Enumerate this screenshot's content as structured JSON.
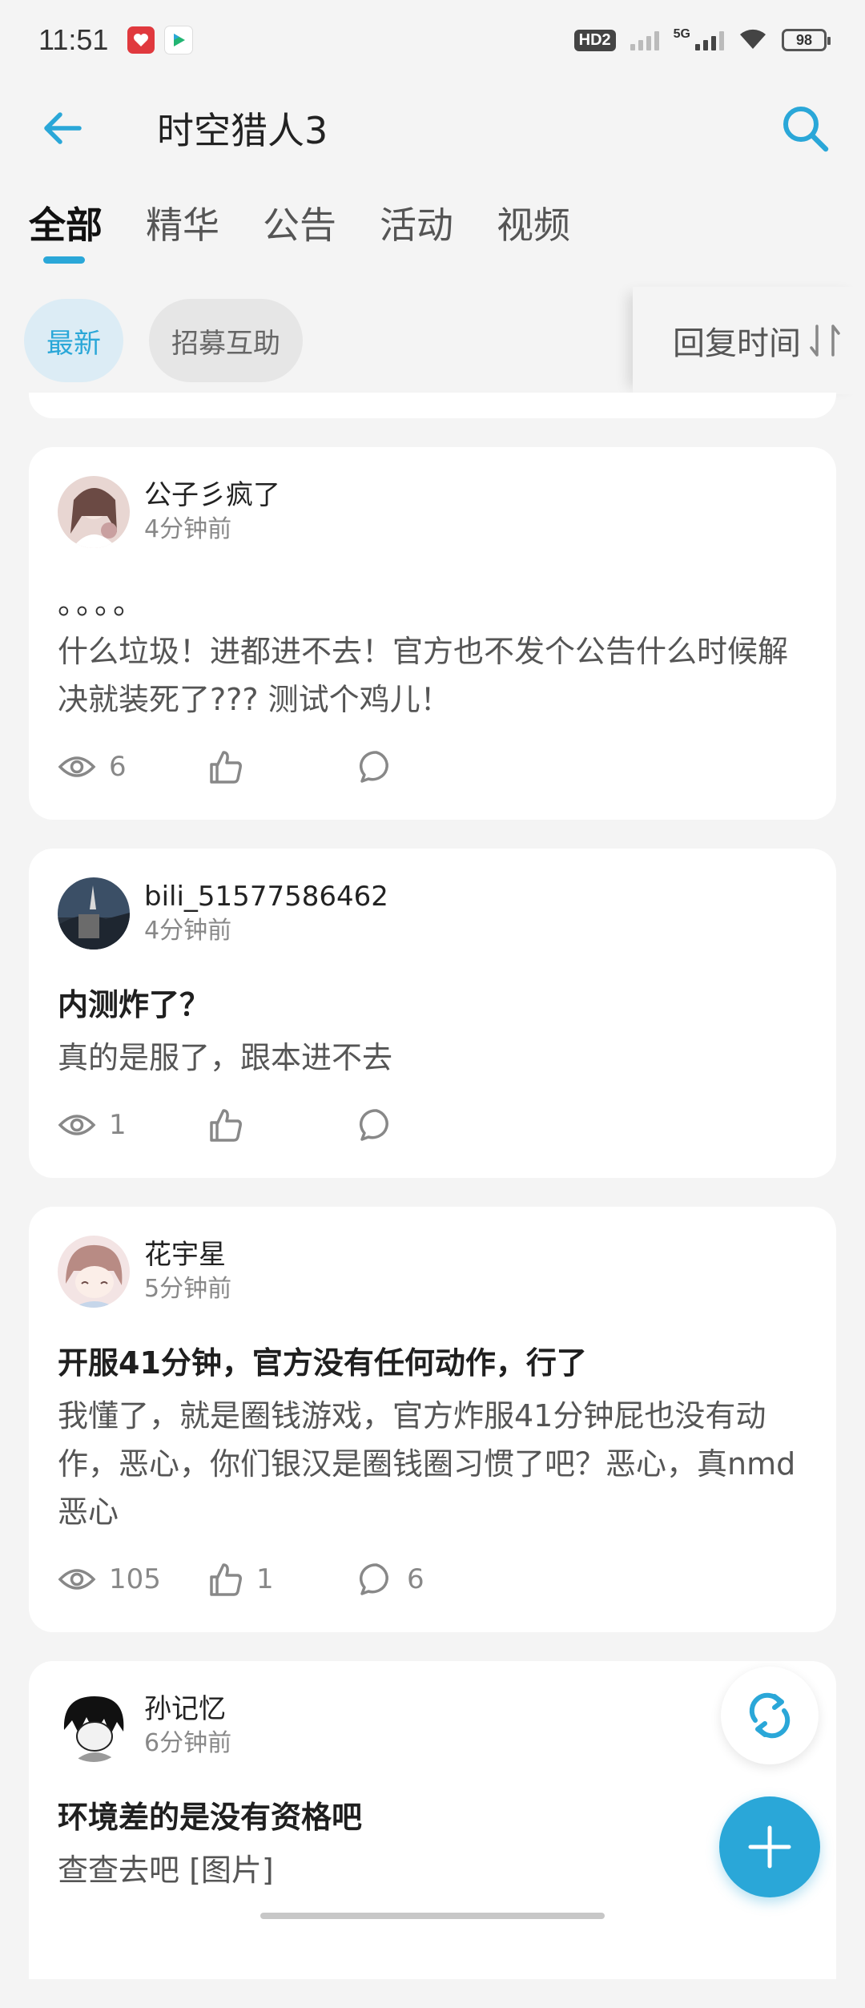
{
  "status_bar": {
    "time": "11:51",
    "hd_label": "HD2",
    "network_label": "5G",
    "battery_level": "98"
  },
  "header": {
    "title": "时空猎人3"
  },
  "tabs": [
    {
      "label": "全部",
      "active": true
    },
    {
      "label": "精华",
      "active": false
    },
    {
      "label": "公告",
      "active": false
    },
    {
      "label": "活动",
      "active": false
    },
    {
      "label": "视频",
      "active": false
    }
  ],
  "filters": {
    "chips": [
      {
        "label": "最新",
        "active": true
      },
      {
        "label": "招募互助",
        "active": false
      }
    ],
    "sort_label": "回复时间"
  },
  "posts": [
    {
      "user": "公子彡疯了",
      "time": "4分钟前",
      "title": "",
      "dots": "。。。。",
      "body": "什么垃圾！进都进不去！官方也不发个公告什么时候解决就装死了???  测试个鸡儿！",
      "views": "6",
      "likes": "",
      "comments": ""
    },
    {
      "user": "bili_51577586462",
      "time": "4分钟前",
      "title": "内测炸了？",
      "body": "真的是服了，跟本进不去",
      "views": "1",
      "likes": "",
      "comments": ""
    },
    {
      "user": "花宇星",
      "time": "5分钟前",
      "title": "开服41分钟，官方没有任何动作，行了",
      "body": "我懂了，就是圈钱游戏，官方炸服41分钟屁也没有动作，恶心，你们银汉是圈钱圈习惯了吧？恶心，真nmd恶心",
      "views": "105",
      "likes": "1",
      "comments": "6"
    },
    {
      "user": "孙记忆",
      "time": "6分钟前",
      "title": "环境差的是没有资格吧",
      "body": "查查去吧 [图片]"
    }
  ],
  "colors": {
    "accent": "#2aa7d8",
    "background": "#f4f4f4",
    "card": "#ffffff"
  }
}
